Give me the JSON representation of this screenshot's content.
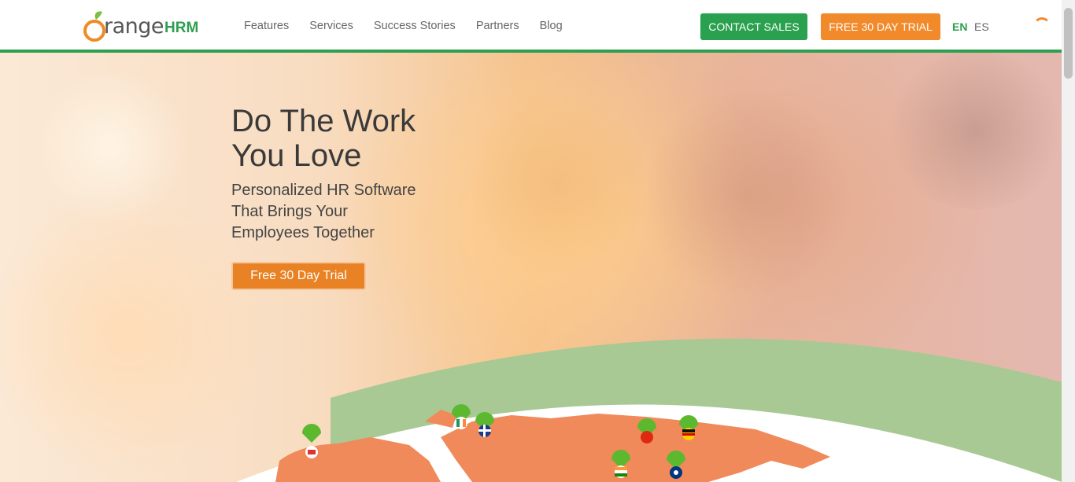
{
  "header": {
    "logo": {
      "word": "range",
      "suffix": "HRM"
    },
    "nav": [
      "Features",
      "Services",
      "Success Stories",
      "Partners",
      "Blog"
    ],
    "contact_label": "CONTACT SALES",
    "trial_label": "FREE 30 DAY TRIAL",
    "lang_en": "EN",
    "lang_es": "ES"
  },
  "hero": {
    "title_line1": "Do The Work",
    "title_line2": "You Love",
    "sub_line1": "Personalized HR Software",
    "sub_line2": "That Brings Your",
    "sub_line3": "Employees Together",
    "cta_label": "Free 30 Day Trial"
  },
  "colors": {
    "brand_green": "#2aa14e",
    "brand_orange": "#f18a2b",
    "map_orange": "#f08a5a",
    "arc_green": "#a8c994"
  },
  "icons": [
    "orange-logo-icon",
    "loading-spinner-icon",
    "map-pin-icon"
  ]
}
